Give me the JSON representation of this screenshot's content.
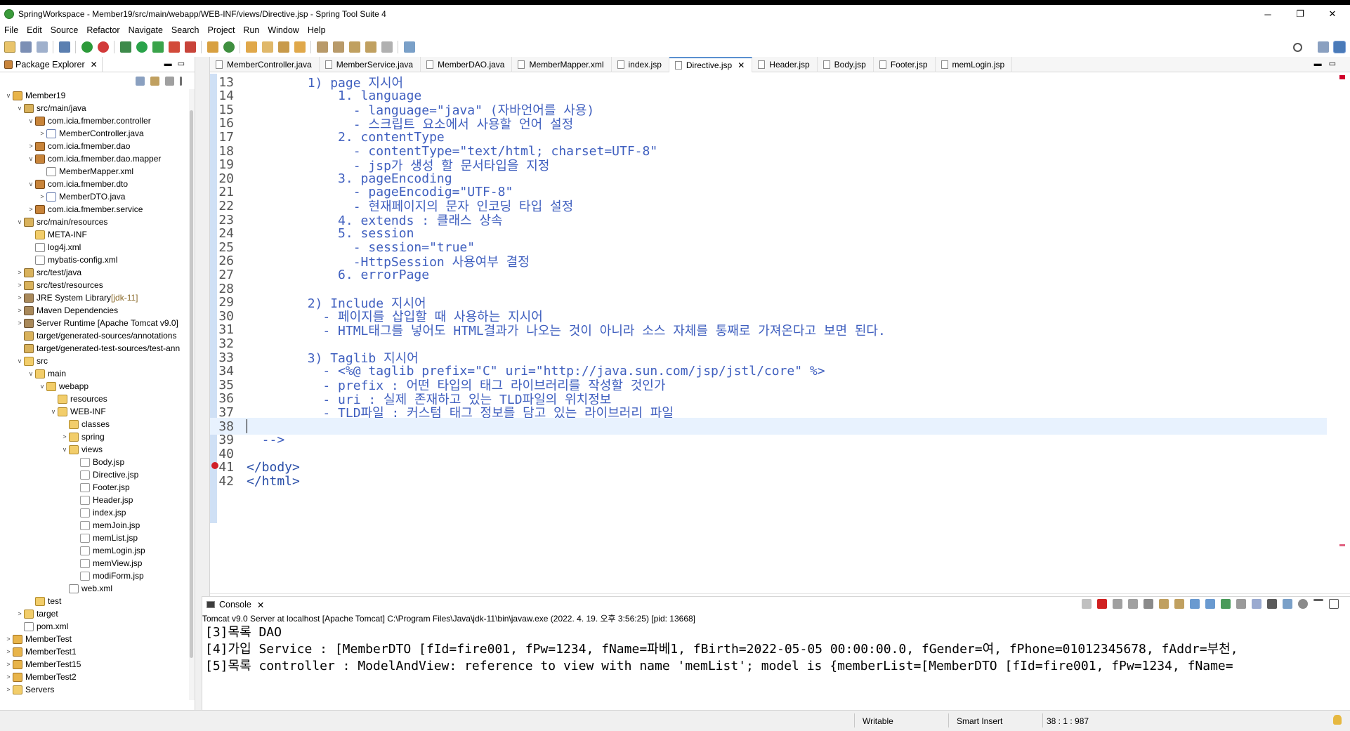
{
  "window": {
    "title": "SpringWorkspace - Member19/src/main/webapp/WEB-INF/views/Directive.jsp - Spring Tool Suite 4",
    "minimize": "─",
    "restore": "❐",
    "close": "✕"
  },
  "menu": [
    "File",
    "Edit",
    "Source",
    "Refactor",
    "Navigate",
    "Search",
    "Project",
    "Run",
    "Window",
    "Help"
  ],
  "package_explorer": {
    "title": "Package Explorer",
    "close": "✕",
    "tree": [
      {
        "label": "Member19",
        "depth": 0,
        "arrow": "v",
        "icon": "project"
      },
      {
        "label": "src/main/java",
        "depth": 1,
        "arrow": "v",
        "icon": "srcfolder"
      },
      {
        "label": "com.icia.fmember.controller",
        "depth": 2,
        "arrow": "v",
        "icon": "package"
      },
      {
        "label": "MemberController.java",
        "depth": 3,
        "arrow": ">",
        "icon": "java"
      },
      {
        "label": "com.icia.fmember.dao",
        "depth": 2,
        "arrow": ">",
        "icon": "package"
      },
      {
        "label": "com.icia.fmember.dao.mapper",
        "depth": 2,
        "arrow": "v",
        "icon": "package"
      },
      {
        "label": "MemberMapper.xml",
        "depth": 3,
        "arrow": "",
        "icon": "xml"
      },
      {
        "label": "com.icia.fmember.dto",
        "depth": 2,
        "arrow": "v",
        "icon": "package"
      },
      {
        "label": "MemberDTO.java",
        "depth": 3,
        "arrow": ">",
        "icon": "java"
      },
      {
        "label": "com.icia.fmember.service",
        "depth": 2,
        "arrow": ">",
        "icon": "package"
      },
      {
        "label": "src/main/resources",
        "depth": 1,
        "arrow": "v",
        "icon": "srcfolder"
      },
      {
        "label": "META-INF",
        "depth": 2,
        "arrow": "",
        "icon": "folder"
      },
      {
        "label": "log4j.xml",
        "depth": 2,
        "arrow": "",
        "icon": "xml"
      },
      {
        "label": "mybatis-config.xml",
        "depth": 2,
        "arrow": "",
        "icon": "xml"
      },
      {
        "label": "src/test/java",
        "depth": 1,
        "arrow": ">",
        "icon": "srcfolder"
      },
      {
        "label": "src/test/resources",
        "depth": 1,
        "arrow": ">",
        "icon": "srcfolder"
      },
      {
        "label": "JRE System Library",
        "suffix": " [jdk-11]",
        "depth": 1,
        "arrow": ">",
        "icon": "lib"
      },
      {
        "label": "Maven Dependencies",
        "depth": 1,
        "arrow": ">",
        "icon": "lib"
      },
      {
        "label": "Server Runtime [Apache Tomcat v9.0]",
        "depth": 1,
        "arrow": ">",
        "icon": "lib"
      },
      {
        "label": "target/generated-sources/annotations",
        "depth": 1,
        "arrow": "",
        "icon": "srcfolder"
      },
      {
        "label": "target/generated-test-sources/test-ann",
        "depth": 1,
        "arrow": "",
        "icon": "srcfolder"
      },
      {
        "label": "src",
        "depth": 1,
        "arrow": "v",
        "icon": "folder"
      },
      {
        "label": "main",
        "depth": 2,
        "arrow": "v",
        "icon": "folder"
      },
      {
        "label": "webapp",
        "depth": 3,
        "arrow": "v",
        "icon": "folder"
      },
      {
        "label": "resources",
        "depth": 4,
        "arrow": "",
        "icon": "folder"
      },
      {
        "label": "WEB-INF",
        "depth": 4,
        "arrow": "v",
        "icon": "folder"
      },
      {
        "label": "classes",
        "depth": 5,
        "arrow": "",
        "icon": "folder"
      },
      {
        "label": "spring",
        "depth": 5,
        "arrow": ">",
        "icon": "folder"
      },
      {
        "label": "views",
        "depth": 5,
        "arrow": "v",
        "icon": "folder"
      },
      {
        "label": "Body.jsp",
        "depth": 6,
        "arrow": "",
        "icon": "jsp"
      },
      {
        "label": "Directive.jsp",
        "depth": 6,
        "arrow": "",
        "icon": "jsp"
      },
      {
        "label": "Footer.jsp",
        "depth": 6,
        "arrow": "",
        "icon": "jsp"
      },
      {
        "label": "Header.jsp",
        "depth": 6,
        "arrow": "",
        "icon": "jsp"
      },
      {
        "label": "index.jsp",
        "depth": 6,
        "arrow": "",
        "icon": "jsp"
      },
      {
        "label": "memJoin.jsp",
        "depth": 6,
        "arrow": "",
        "icon": "jsp"
      },
      {
        "label": "memList.jsp",
        "depth": 6,
        "arrow": "",
        "icon": "jsp"
      },
      {
        "label": "memLogin.jsp",
        "depth": 6,
        "arrow": "",
        "icon": "jsp"
      },
      {
        "label": "memView.jsp",
        "depth": 6,
        "arrow": "",
        "icon": "jsp"
      },
      {
        "label": "modiForm.jsp",
        "depth": 6,
        "arrow": "",
        "icon": "jsp"
      },
      {
        "label": "web.xml",
        "depth": 5,
        "arrow": "",
        "icon": "xml"
      },
      {
        "label": "test",
        "depth": 2,
        "arrow": "",
        "icon": "folder"
      },
      {
        "label": "target",
        "depth": 1,
        "arrow": ">",
        "icon": "folder"
      },
      {
        "label": "pom.xml",
        "depth": 1,
        "arrow": "",
        "icon": "xml"
      },
      {
        "label": "MemberTest",
        "depth": 0,
        "arrow": ">",
        "icon": "project"
      },
      {
        "label": "MemberTest1",
        "depth": 0,
        "arrow": ">",
        "icon": "project"
      },
      {
        "label": "MemberTest15",
        "depth": 0,
        "arrow": ">",
        "icon": "project"
      },
      {
        "label": "MemberTest2",
        "depth": 0,
        "arrow": ">",
        "icon": "project"
      },
      {
        "label": "Servers",
        "depth": 0,
        "arrow": ">",
        "icon": "folder"
      }
    ]
  },
  "editor": {
    "tabs": [
      {
        "label": "MemberController.java",
        "active": false
      },
      {
        "label": "MemberService.java",
        "active": false
      },
      {
        "label": "MemberDAO.java",
        "active": false
      },
      {
        "label": "MemberMapper.xml",
        "active": false
      },
      {
        "label": "index.jsp",
        "active": false
      },
      {
        "label": "Directive.jsp",
        "active": true
      },
      {
        "label": "Header.jsp",
        "active": false
      },
      {
        "label": "Body.jsp",
        "active": false
      },
      {
        "label": "Footer.jsp",
        "active": false
      },
      {
        "label": "memLogin.jsp",
        "active": false
      }
    ],
    "tab_close": "✕",
    "lines": [
      {
        "n": "13",
        "t": "        1) page 지시어"
      },
      {
        "n": "14",
        "t": "            1. language"
      },
      {
        "n": "15",
        "t": "              - language=\"java\" (자바언어를 사용)"
      },
      {
        "n": "16",
        "t": "              - 스크립트 요소에서 사용할 언어 설정"
      },
      {
        "n": "17",
        "t": "            2. contentType"
      },
      {
        "n": "18",
        "t": "              - contentType=\"text/html; charset=UTF-8\""
      },
      {
        "n": "19",
        "t": "              - jsp가 생성 할 문서타입을 지정"
      },
      {
        "n": "20",
        "t": "            3. pageEncoding"
      },
      {
        "n": "21",
        "t": "              - pageEncodig=\"UTF-8\""
      },
      {
        "n": "22",
        "t": "              - 현재페이지의 문자 인코딩 타입 설정"
      },
      {
        "n": "23",
        "t": "            4. extends : 클래스 상속"
      },
      {
        "n": "24",
        "t": "            5. session"
      },
      {
        "n": "25",
        "t": "              - session=\"true\""
      },
      {
        "n": "26",
        "t": "              -HttpSession 사용여부 결정"
      },
      {
        "n": "27",
        "t": "            6. errorPage"
      },
      {
        "n": "28",
        "t": ""
      },
      {
        "n": "29",
        "t": "        2) Include 지시어"
      },
      {
        "n": "30",
        "t": "          - 페이지를 삽입할 때 사용하는 지시어"
      },
      {
        "n": "31",
        "t": "          - HTML태그를 넣어도 HTML결과가 나오는 것이 아니라 소스 자체를 통째로 가져온다고 보면 된다."
      },
      {
        "n": "32",
        "t": ""
      },
      {
        "n": "33",
        "t": "        3) Taglib 지시어"
      },
      {
        "n": "34",
        "t": "          - <%@ taglib prefix=\"C\" uri=\"http://java.sun.com/jsp/jstl/core\" %>"
      },
      {
        "n": "35",
        "t": "          - prefix : 어떤 타입의 태그 라이브러리를 작성할 것인가"
      },
      {
        "n": "36",
        "t": "          - uri : 실제 존재하고 있는 TLD파일의 위치정보"
      },
      {
        "n": "37",
        "t": "          - TLD파일 : 커스텀 태그 정보를 담고 있는 라이브러리 파일"
      },
      {
        "n": "38",
        "t": ""
      },
      {
        "n": "39",
        "t": "  -->"
      },
      {
        "n": "40",
        "t": ""
      },
      {
        "n": "41",
        "t": "</body>"
      },
      {
        "n": "42",
        "t": "</html>"
      }
    ]
  },
  "console": {
    "title": "Console",
    "close": "✕",
    "description": "Tomcat v9.0 Server at localhost [Apache Tomcat] C:\\Program Files\\Java\\jdk-11\\bin\\javaw.exe  (2022. 4. 19. 오후 3:56:25) [pid: 13668]",
    "output": [
      "[3]목록 DAO",
      "[4]가입 Service : [MemberDTO [fId=fire001, fPw=1234, fName=파베1, fBirth=2022-05-05 00:00:00.0, fGender=여, fPhone=01012345678, fAddr=부천,",
      "[5]목록 controller : ModelAndView: reference to view with name 'memList'; model is {memberList=[MemberDTO [fId=fire001, fPw=1234, fName="
    ]
  },
  "status": {
    "writable": "Writable",
    "insert_mode": "Smart Insert",
    "position": "38 : 1 : 987"
  },
  "colors": {
    "comment": "#3f5fbf",
    "tag": "#2a4fa8",
    "accent": "#5a8fd0",
    "current_line": "#e8f2fe"
  }
}
